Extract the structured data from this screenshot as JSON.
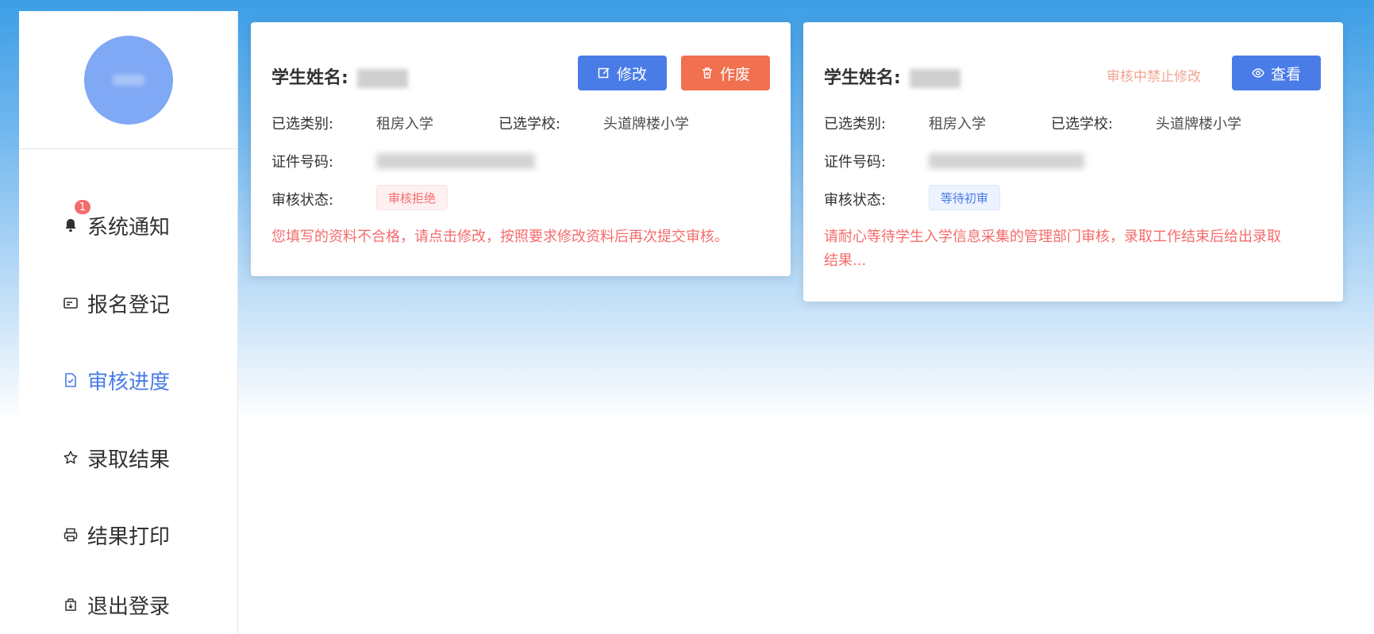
{
  "sidebar": {
    "avatar_alt": "",
    "notification_badge": "1",
    "items": [
      {
        "label": "系统通知",
        "icon": "bell-icon"
      },
      {
        "label": "报名登记",
        "icon": "id-card-icon"
      },
      {
        "label": "审核进度",
        "icon": "document-check-icon",
        "active": true
      },
      {
        "label": "录取结果",
        "icon": "star-icon"
      },
      {
        "label": "结果打印",
        "icon": "printer-icon"
      },
      {
        "label": "退出登录",
        "icon": "logout-icon"
      }
    ]
  },
  "cards": [
    {
      "title": "学生姓名: ",
      "buttons": {
        "edit": "修改",
        "void": "作废"
      },
      "category_label": "已选类别:",
      "category_value": "租房入学",
      "school_label": "已选学校:",
      "school_value": "头道牌楼小学",
      "id_label": "证件号码:",
      "status_label": "审核状态:",
      "status_value": "审核拒绝",
      "message": "您填写的资料不合格，请点击修改，按照要求修改资料后再次提交审核。"
    },
    {
      "title": "学生姓名: ",
      "lock_text": "审核中禁止修改",
      "buttons": {
        "view": "查看"
      },
      "category_label": "已选类别:",
      "category_value": "租房入学",
      "school_label": "已选学校:",
      "school_value": "头道牌楼小学",
      "id_label": "证件号码:",
      "status_label": "审核状态:",
      "status_value": "等待初审",
      "message_line1": "请耐心等待学生入学信息采集的管理部门审核，录取工作结束后给出录取",
      "message_line2": "结果..."
    }
  ],
  "colors": {
    "primary": "#4a7ce8",
    "danger": "#f07050",
    "reject_text": "#f56c6c",
    "lock_text": "#f2a592"
  }
}
